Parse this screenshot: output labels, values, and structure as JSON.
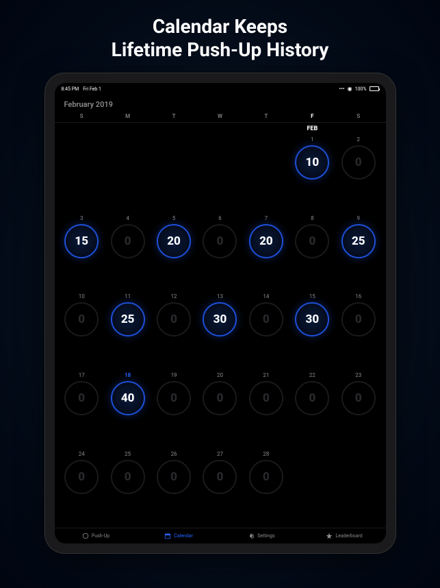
{
  "marketing": {
    "line1": "Calendar Keeps",
    "line2": "Lifetime Push-Up History"
  },
  "statusBar": {
    "time": "8:45 PM",
    "date": "Fri Feb 1",
    "batteryPct": "100%"
  },
  "monthTitle": "February 2019",
  "weekdays": [
    "S",
    "M",
    "T",
    "W",
    "T",
    "F",
    "S"
  ],
  "activeWeekdayIndex": 5,
  "monthAbbr": "FEB",
  "days": [
    {
      "num": "",
      "val": null,
      "filled": false
    },
    {
      "num": "",
      "val": null,
      "filled": false
    },
    {
      "num": "",
      "val": null,
      "filled": false
    },
    {
      "num": "",
      "val": null,
      "filled": false
    },
    {
      "num": "",
      "val": null,
      "filled": false
    },
    {
      "num": "1",
      "val": "10",
      "filled": true
    },
    {
      "num": "2",
      "val": "0",
      "filled": false
    },
    {
      "num": "3",
      "val": "15",
      "filled": true
    },
    {
      "num": "4",
      "val": "0",
      "filled": false
    },
    {
      "num": "5",
      "val": "20",
      "filled": true
    },
    {
      "num": "6",
      "val": "0",
      "filled": false
    },
    {
      "num": "7",
      "val": "20",
      "filled": true
    },
    {
      "num": "8",
      "val": "0",
      "filled": false
    },
    {
      "num": "9",
      "val": "25",
      "filled": true
    },
    {
      "num": "10",
      "val": "0",
      "filled": false
    },
    {
      "num": "11",
      "val": "25",
      "filled": true
    },
    {
      "num": "12",
      "val": "0",
      "filled": false
    },
    {
      "num": "13",
      "val": "30",
      "filled": true
    },
    {
      "num": "14",
      "val": "0",
      "filled": false
    },
    {
      "num": "15",
      "val": "30",
      "filled": true
    },
    {
      "num": "16",
      "val": "0",
      "filled": false
    },
    {
      "num": "17",
      "val": "0",
      "filled": false
    },
    {
      "num": "18",
      "val": "40",
      "filled": true,
      "today": true
    },
    {
      "num": "19",
      "val": "0",
      "filled": false
    },
    {
      "num": "20",
      "val": "0",
      "filled": false
    },
    {
      "num": "21",
      "val": "0",
      "filled": false
    },
    {
      "num": "22",
      "val": "0",
      "filled": false
    },
    {
      "num": "23",
      "val": "0",
      "filled": false
    },
    {
      "num": "24",
      "val": "0",
      "filled": false
    },
    {
      "num": "25",
      "val": "0",
      "filled": false
    },
    {
      "num": "26",
      "val": "0",
      "filled": false
    },
    {
      "num": "27",
      "val": "0",
      "filled": false
    },
    {
      "num": "28",
      "val": "0",
      "filled": false
    },
    {
      "num": "",
      "val": null,
      "filled": false
    },
    {
      "num": "",
      "val": null,
      "filled": false
    }
  ],
  "tabs": [
    {
      "label": "Push-Up",
      "icon": "circle"
    },
    {
      "label": "Calendar",
      "icon": "calendar",
      "active": true
    },
    {
      "label": "Settings",
      "icon": "gear"
    },
    {
      "label": "Leaderboard",
      "icon": "star"
    }
  ]
}
